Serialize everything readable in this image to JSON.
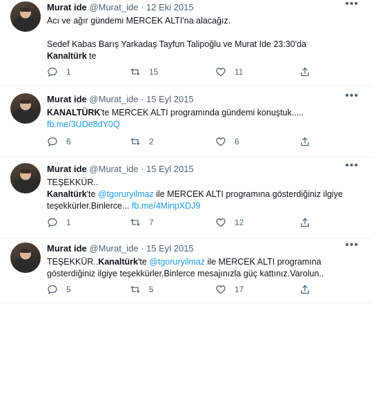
{
  "tweets": [
    {
      "name": "Murat ide",
      "handle": "@Murat_ide",
      "dot": "·",
      "date": "12 Eki 2015",
      "lines": [
        [
          {
            "t": "Acı ve ağır gündemi MERCEK ALTI'na alacağız."
          }
        ],
        [],
        [
          {
            "t": "Sedef Kabas  Barış Yarkadaş Tayfun Talipoğlu ve Murat Ide  23:30'da"
          }
        ],
        [
          {
            "t": "Kanaltürk",
            "b": true
          },
          {
            "t": " te"
          }
        ]
      ],
      "replies": "1",
      "retweets": "15",
      "likes": "11"
    },
    {
      "name": "Murat ide",
      "handle": "@Murat_ide",
      "dot": "·",
      "date": "15 Eyl 2015",
      "lines": [
        [
          {
            "t": "KANALTÜRK",
            "b": true
          },
          {
            "t": "'te MERCEK ALTI programında gündemi konuştuk....."
          }
        ],
        [
          {
            "t": "fb.me/3UDe8dY0Q",
            "l": true
          }
        ]
      ],
      "replies": "6",
      "retweets": "2",
      "likes": "6"
    },
    {
      "name": "Murat ide",
      "handle": "@Murat_ide",
      "dot": "·",
      "date": "15 Eyl 2015",
      "lines": [
        [
          {
            "t": "TEŞEKKÜR.."
          }
        ],
        [
          {
            "t": "Kanaltürk",
            "b": true
          },
          {
            "t": "'te "
          },
          {
            "t": "@tgoruryilmaz",
            "l": true
          },
          {
            "t": " ile MERCEK ALTI programına gösterdiğiniz ilgiye"
          }
        ],
        [
          {
            "t": "teşekkürler.Binlerce... "
          },
          {
            "t": "fb.me/4MinpXDJ9",
            "l": true
          }
        ]
      ],
      "replies": "1",
      "retweets": "7",
      "likes": "12"
    },
    {
      "name": "Murat ide",
      "handle": "@Murat_ide",
      "dot": "·",
      "date": "15 Eyl 2015",
      "lines": [
        [
          {
            "t": "TEŞEKKÜR.."
          },
          {
            "t": "Kanaltürk",
            "b": true
          },
          {
            "t": "'te "
          },
          {
            "t": "@tgoruryilmaz",
            "l": true
          },
          {
            "t": " ile MERCEK ALTI programına"
          }
        ],
        [
          {
            "t": "gösterdiğiniz ilgiye teşekkürler.Binlerce mesajınızla güç kattınız.Varolun.."
          }
        ]
      ],
      "replies": "5",
      "retweets": "5",
      "likes": "17"
    }
  ],
  "icons": {
    "more": "more-icon",
    "reply": "reply-icon",
    "retweet": "retweet-icon",
    "like": "heart-icon",
    "share": "share-icon"
  },
  "colors": {
    "text": "#0f1419",
    "muted": "#536471",
    "link": "#1d9bf0",
    "divider": "#eff3f4"
  }
}
